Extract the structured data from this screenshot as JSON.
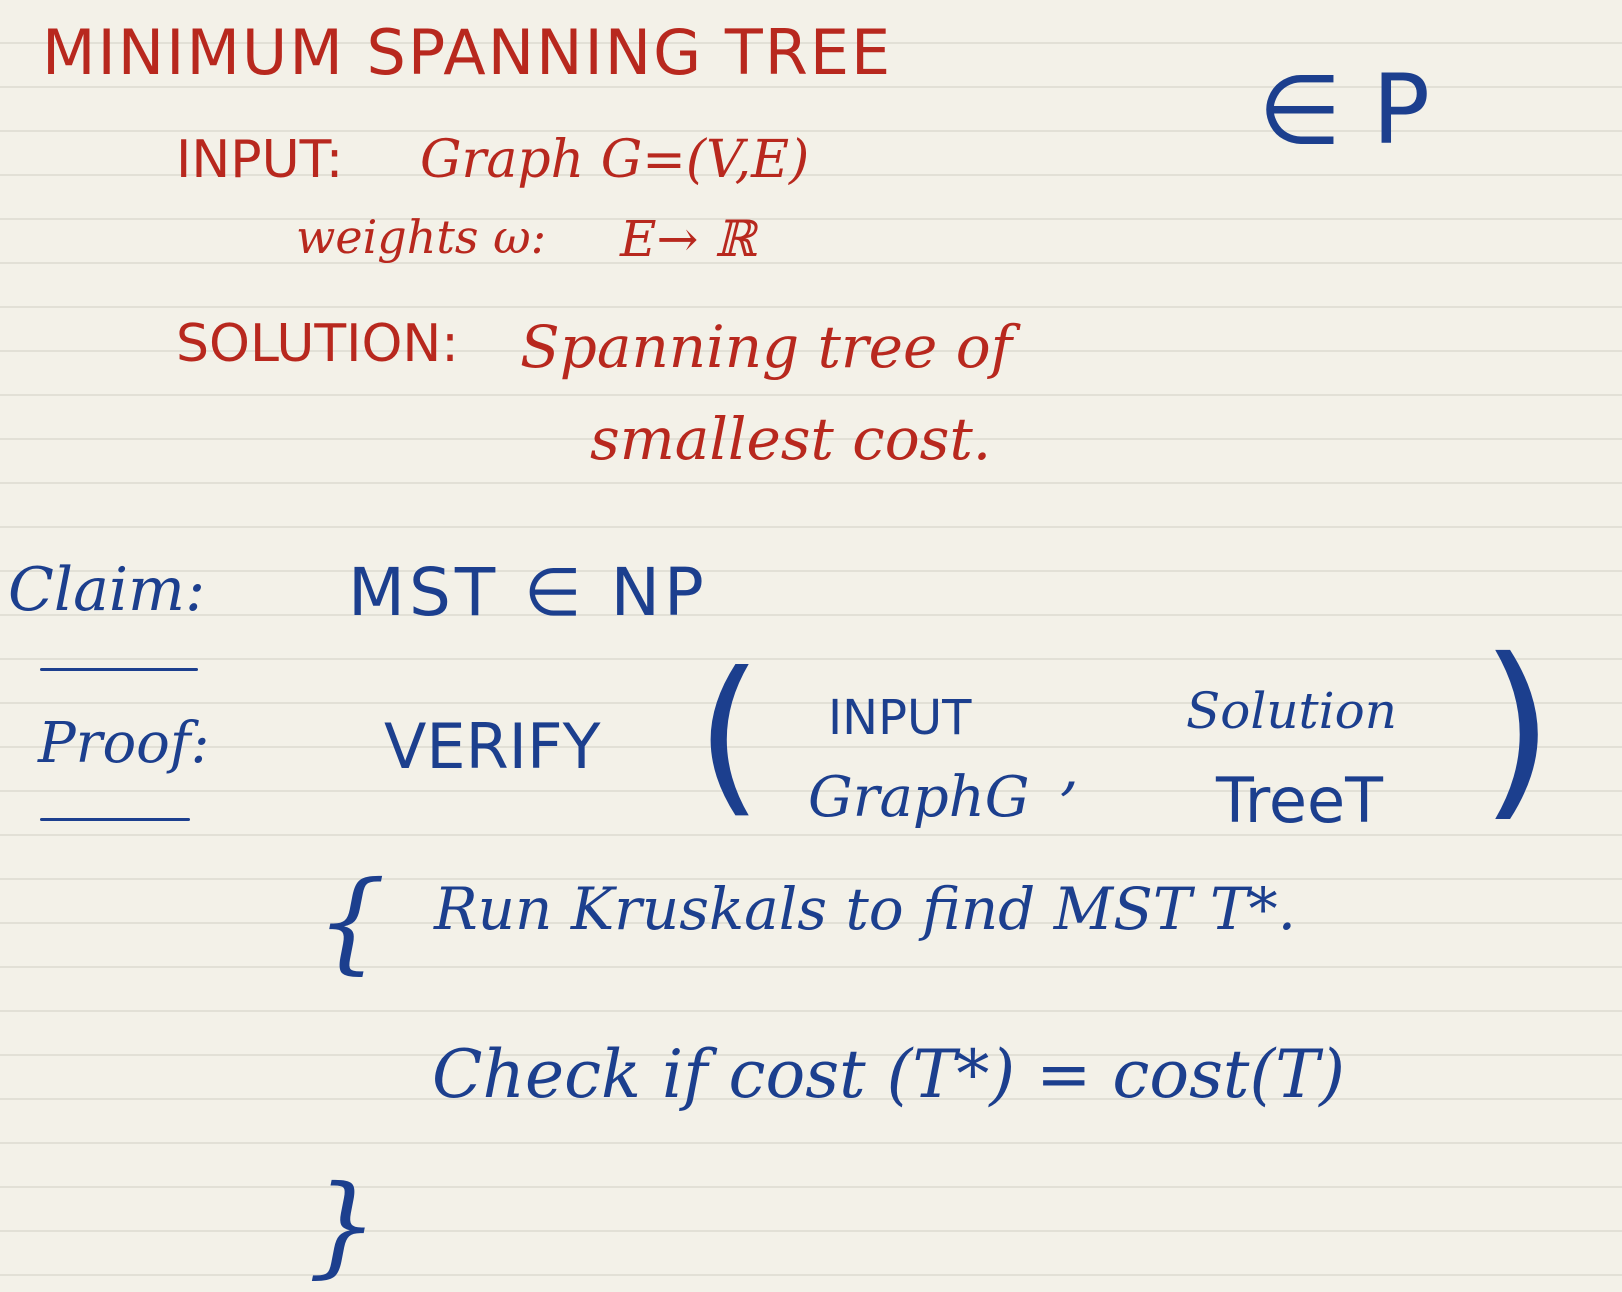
{
  "header": {
    "title": "MINIMUM SPANNING TREE",
    "complexity_class": "∈ P"
  },
  "problem": {
    "input_label": "INPUT:",
    "input_text": "Graph G=(V,E)",
    "weights_label": "weights ω:",
    "weights_text": "E→ ℝ",
    "solution_label": "SOLUTION:",
    "solution_line1": "Spanning tree of",
    "solution_line2": "smallest cost."
  },
  "claim": {
    "label": "Claim:",
    "text": "MST ∈ NP"
  },
  "proof": {
    "label": "Proof:",
    "verify_label": "VERIFY",
    "paren_open": "(",
    "paren_close": ")",
    "arg1_top": "INPUT",
    "arg1_bottom": "GraphG",
    "comma": ",",
    "arg2_top": "Solution",
    "arg2_bottom": "TreeT",
    "brace_open": "{",
    "step1": "Run Kruskals to find MST T*.",
    "step2": "Check if cost (T*) = cost(T)",
    "brace_close": "}"
  },
  "colors": {
    "red_ink": "#b8281e",
    "blue_ink": "#1c3f8e",
    "paper": "#f3f1e8"
  }
}
